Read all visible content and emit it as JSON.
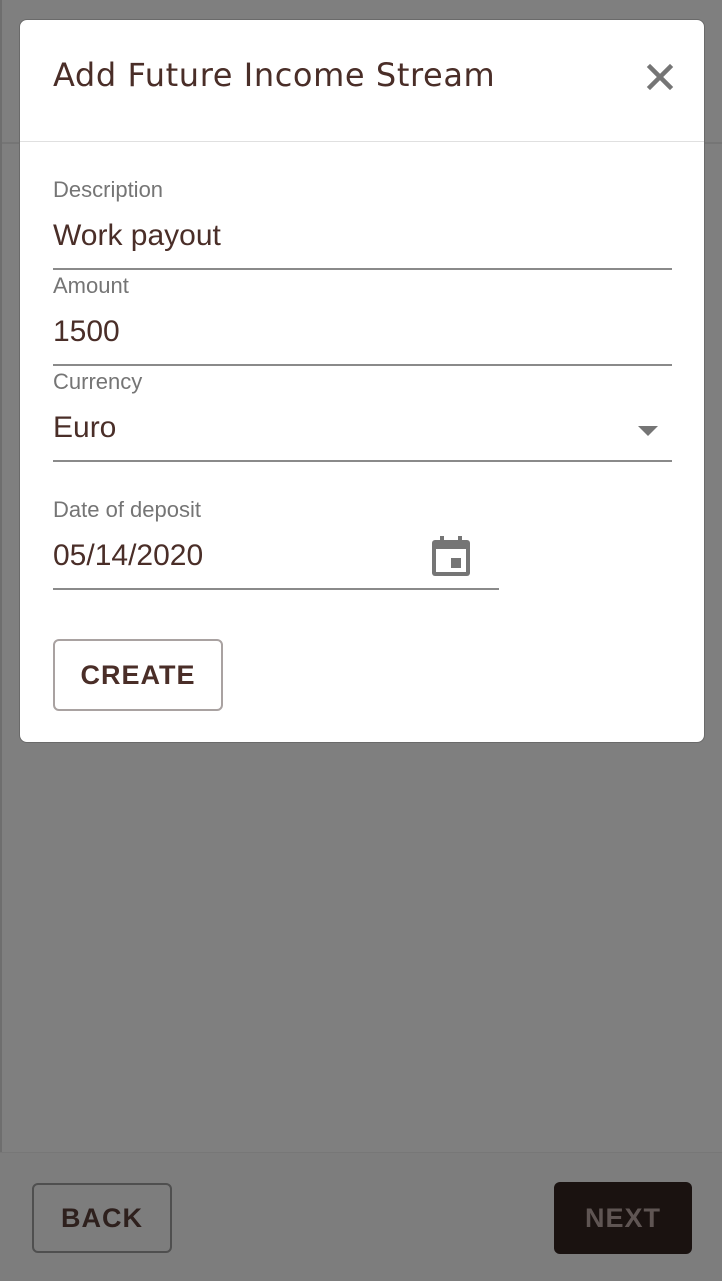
{
  "dialog": {
    "title": "Add Future Income Stream",
    "close_icon": "close-icon",
    "fields": {
      "description": {
        "label": "Description",
        "value": "Work payout"
      },
      "amount": {
        "label": "Amount",
        "value": "1500"
      },
      "currency": {
        "label": "Currency",
        "value": "Euro"
      },
      "date": {
        "label": "Date of deposit",
        "value": "05/14/2020"
      }
    },
    "create_label": "CREATE"
  },
  "footer": {
    "back_label": "BACK",
    "next_label": "NEXT"
  },
  "colors": {
    "text_primary": "#4a2e28",
    "overlay": "#7f7f7f",
    "next_button_bg": "#1a1210"
  }
}
